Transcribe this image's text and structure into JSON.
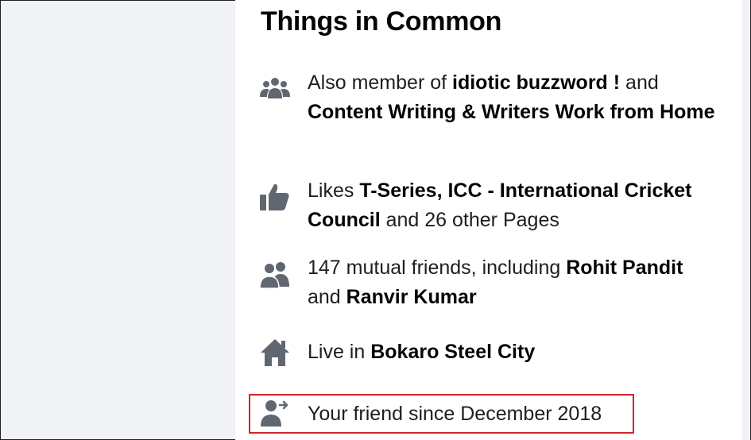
{
  "section": {
    "title": "Things in Common"
  },
  "items": [
    {
      "icon": "groups-icon",
      "parts": [
        "Also member of ",
        "idiotic buzzword !",
        " and ",
        "Content Writing & Writers Work from Home"
      ]
    },
    {
      "icon": "thumbs-up-icon",
      "parts": [
        "Likes ",
        "T-Series, ICC - International Cricket Council",
        " and 26 other Pages"
      ]
    },
    {
      "icon": "mutual-friends-icon",
      "parts": [
        "147 mutual friends, including ",
        "Rohit Pandit",
        " and ",
        "Ranvir Kumar"
      ]
    },
    {
      "icon": "home-icon",
      "parts": [
        "Live in ",
        "Bokaro Steel City"
      ]
    },
    {
      "icon": "friend-since-icon",
      "parts": [
        "Your friend since December 2018"
      ]
    }
  ],
  "colors": {
    "icon": "#606770",
    "highlight_border": "#d1242f"
  }
}
